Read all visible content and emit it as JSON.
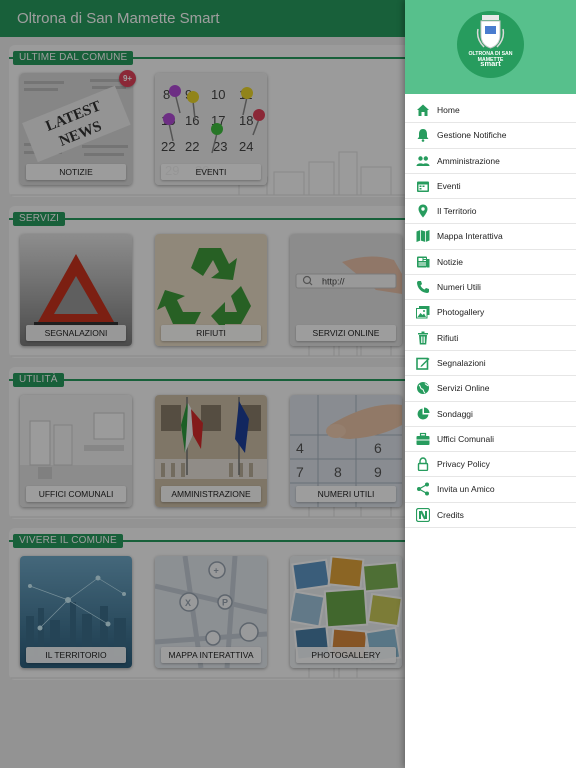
{
  "app": {
    "title": "Oltrona di San Mamette Smart"
  },
  "sections": [
    {
      "title": "ULTIME DAL COMUNE",
      "tiles": [
        {
          "label": "NOTIZIE",
          "icon": "newspaper"
        },
        {
          "label": "EVENTI",
          "icon": "calendar"
        }
      ]
    },
    {
      "title": "SERVIZI",
      "tiles": [
        {
          "label": "SEGNALAZIONI",
          "icon": "warning-triangle"
        },
        {
          "label": "RIFIUTI",
          "icon": "recycle"
        },
        {
          "label": "SERVIZI ONLINE",
          "icon": "web-search"
        }
      ]
    },
    {
      "title": "UTILITÀ",
      "tiles": [
        {
          "label": "UFFICI COMUNALI",
          "icon": "office"
        },
        {
          "label": "AMMINISTRAZIONE",
          "icon": "flags"
        },
        {
          "label": "NUMERI UTILI",
          "icon": "keypad"
        }
      ]
    },
    {
      "title": "VIVERE IL COMUNE",
      "tiles": [
        {
          "label": "IL TERRITORIO",
          "icon": "city-network"
        },
        {
          "label": "MAPPA INTERATTIVA",
          "icon": "map"
        },
        {
          "label": "PHOTOGALLERY",
          "icon": "photos"
        }
      ]
    }
  ],
  "badge": {
    "notizie": "9+"
  },
  "drawer": {
    "logo_name": "OLTRONA DI SAN MAMETTE",
    "logo_smart": "smart",
    "items": [
      {
        "label": "Home",
        "icon": "home-icon"
      },
      {
        "label": "Gestione Notifiche",
        "icon": "bell-icon"
      },
      {
        "label": "Amministrazione",
        "icon": "people-icon"
      },
      {
        "label": "Eventi",
        "icon": "calendar-icon"
      },
      {
        "label": "Il Territorio",
        "icon": "map-pin-icon"
      },
      {
        "label": "Mappa Interattiva",
        "icon": "map-icon"
      },
      {
        "label": "Notizie",
        "icon": "newspaper-icon"
      },
      {
        "label": "Numeri Utili",
        "icon": "phone-icon"
      },
      {
        "label": "Photogallery",
        "icon": "image-icon"
      },
      {
        "label": "Rifiuti",
        "icon": "trash-icon"
      },
      {
        "label": "Segnalazioni",
        "icon": "report-icon"
      },
      {
        "label": "Servizi Online",
        "icon": "globe-icon"
      },
      {
        "label": "Sondaggi",
        "icon": "pie-chart-icon"
      },
      {
        "label": "Uffici Comunali",
        "icon": "briefcase-icon"
      },
      {
        "label": "Privacy Policy",
        "icon": "lock-icon"
      },
      {
        "label": "Invita un Amico",
        "icon": "share-icon"
      },
      {
        "label": "Credits",
        "icon": "credits-icon"
      }
    ]
  },
  "colors": {
    "primary": "#279c5e",
    "drawer_header": "#57c08c",
    "badge": "#e0425a",
    "icon_green": "#279c5e"
  }
}
